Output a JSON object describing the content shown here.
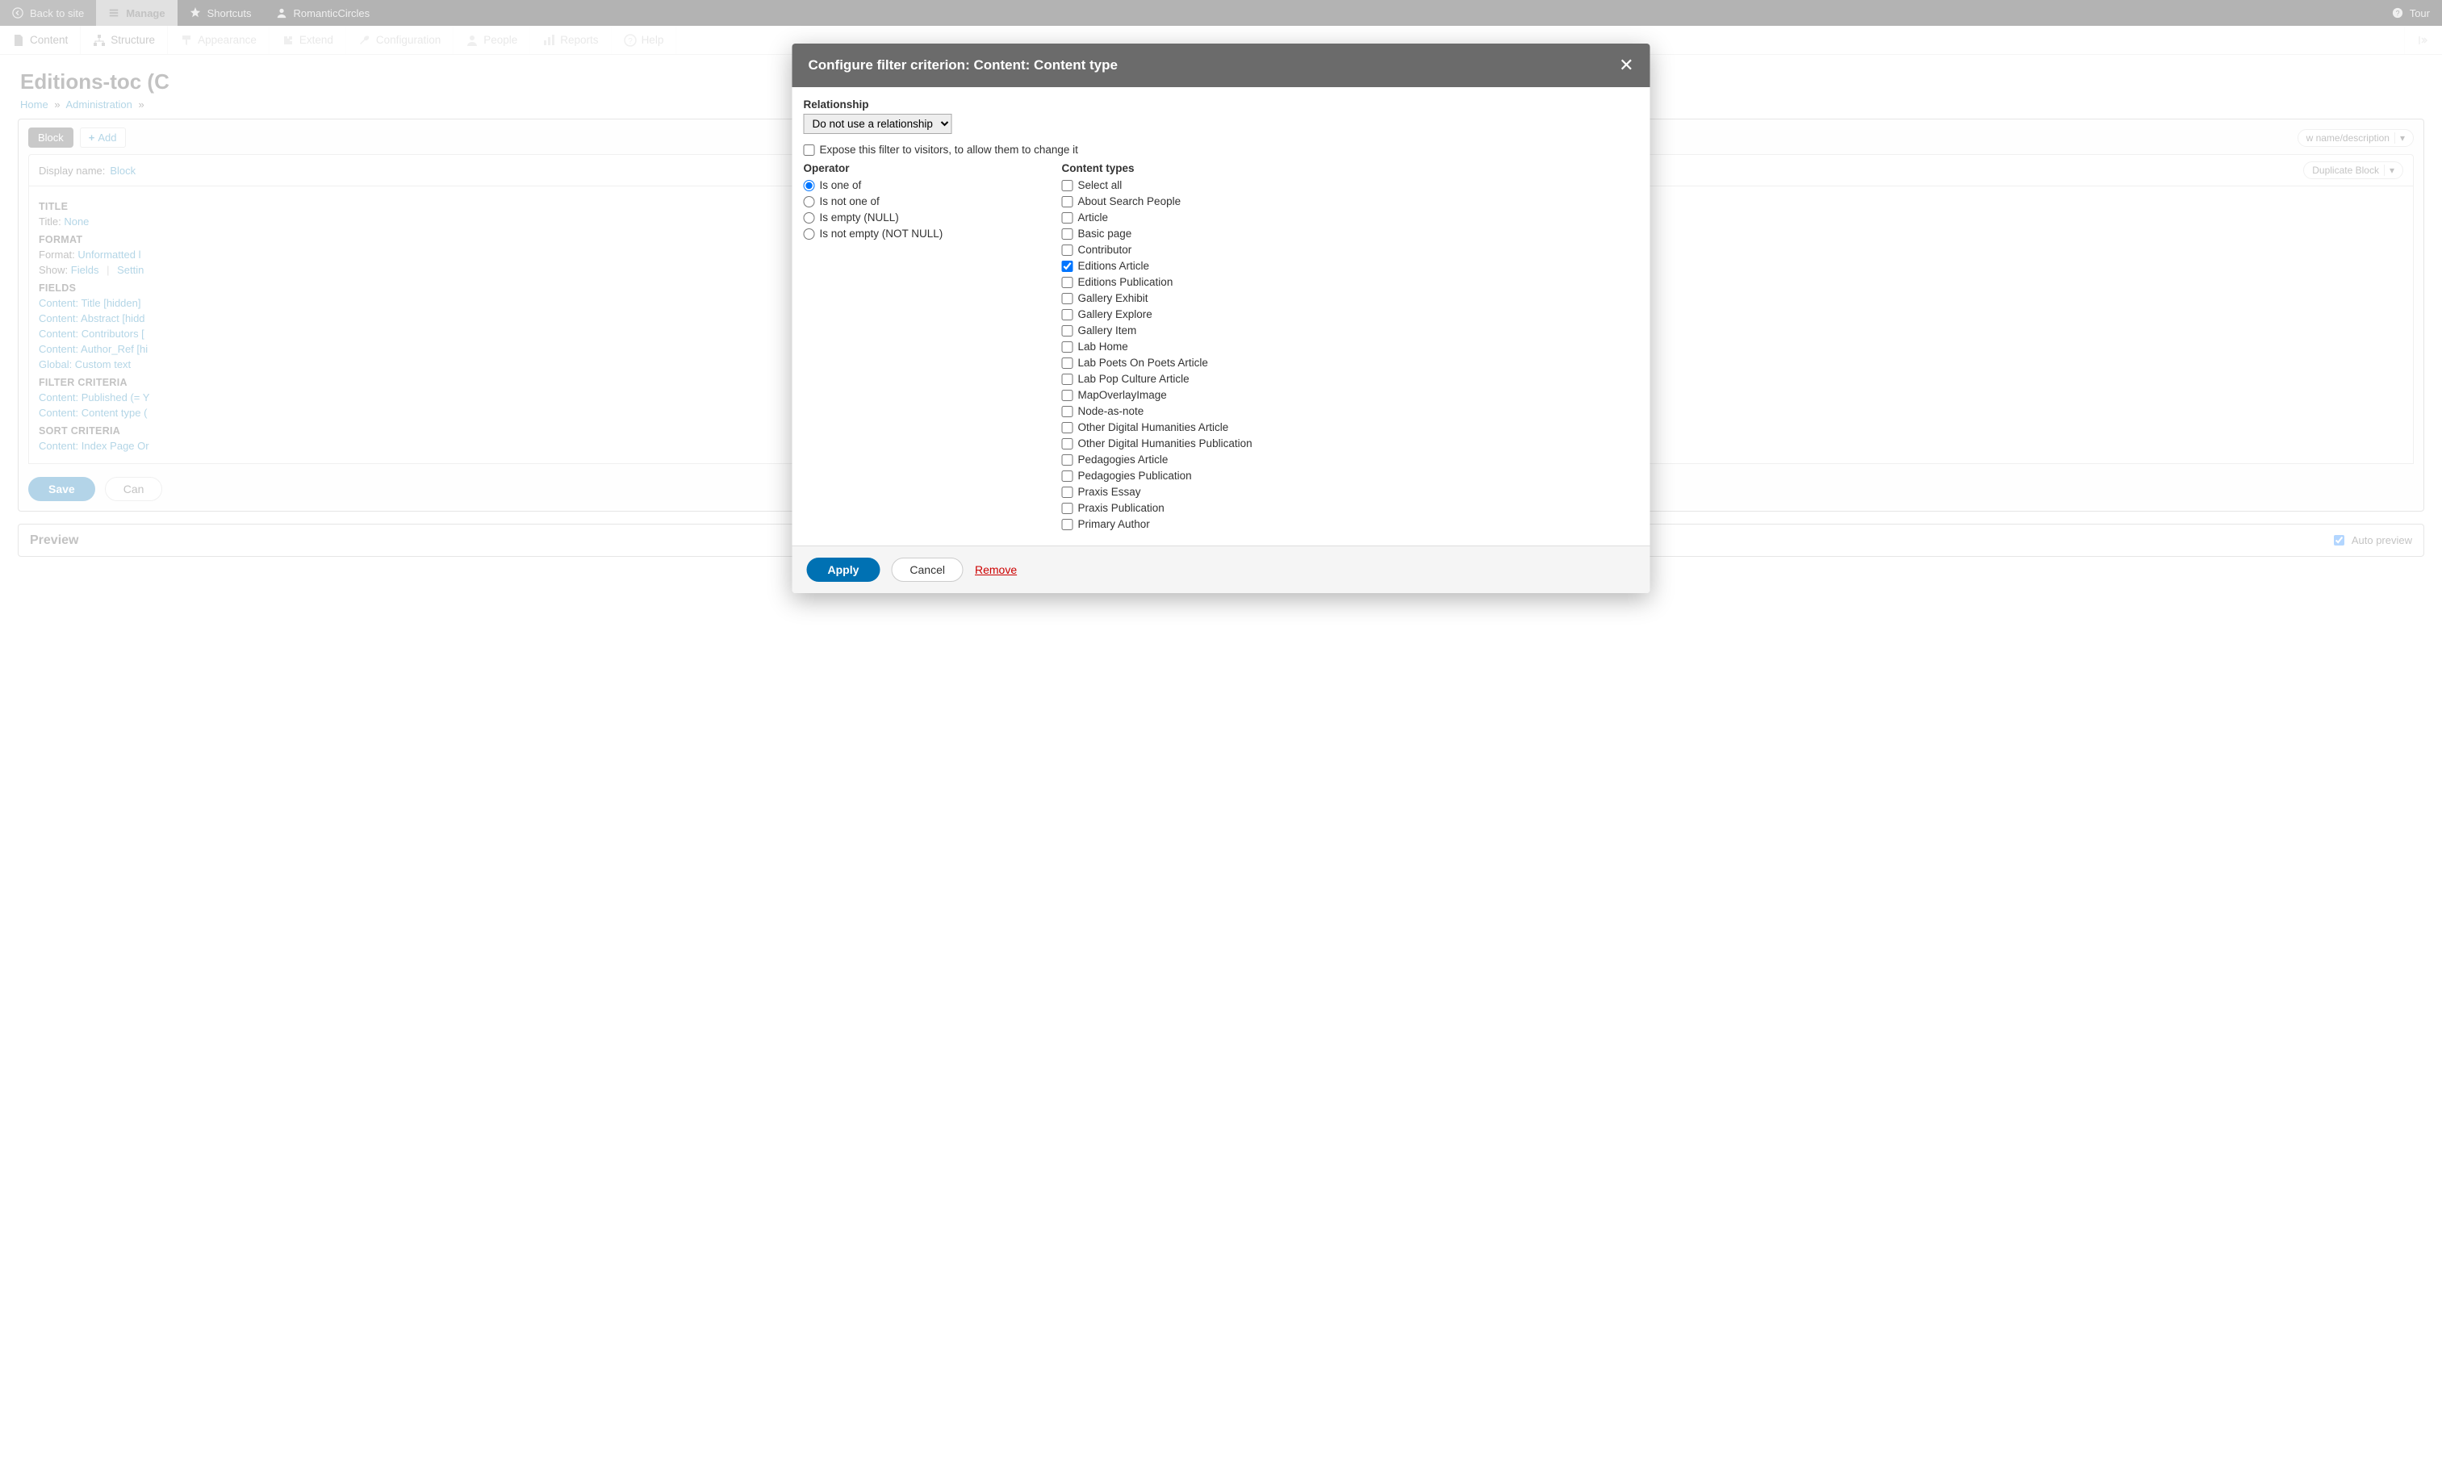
{
  "toolbar": {
    "back": "Back to site",
    "manage": "Manage",
    "shortcuts": "Shortcuts",
    "user": "RomanticCircles",
    "tour": "Tour"
  },
  "admin_menu": {
    "content": "Content",
    "structure": "Structure",
    "appearance": "Appearance",
    "extend": "Extend",
    "config": "Configuration",
    "people": "People",
    "reports": "Reports",
    "help": "Help"
  },
  "page": {
    "title": "Editions-toc (C"
  },
  "breadcrumb": {
    "home": "Home",
    "admin": "Administration"
  },
  "tabs": {
    "block": "Block",
    "add": "Add",
    "editview": "w name/description",
    "duplicate": "Duplicate Block"
  },
  "display": {
    "label": "Display name:",
    "value": "Block"
  },
  "sections": {
    "title": "TITLE",
    "title_label": "Title:",
    "title_value": "None",
    "format": "FORMAT",
    "format_label": "Format:",
    "format_value": "Unformatted l",
    "show_label": "Show:",
    "show_value": "Fields",
    "show_settings": "Settin",
    "fields": "FIELDS",
    "f1": "Content: Title [hidden]",
    "f2": "Content: Abstract [hidd",
    "f3": "Content: Contributors [",
    "f4": "Content: Author_Ref [hi",
    "f5": "Global: Custom text",
    "filter": "FILTER CRITERIA",
    "fc1": "Content: Published (= Y",
    "fc2": "Content: Content type (",
    "sort": "SORT CRITERIA",
    "s1": "Content: Index Page Or"
  },
  "actions": {
    "save": "Save",
    "cancel": "Can"
  },
  "preview": {
    "title": "Preview",
    "auto": "Auto preview"
  },
  "modal": {
    "title": "Configure filter criterion: Content: Content type",
    "relationship_label": "Relationship",
    "relationship_value": "Do not use a relationship",
    "expose": "Expose this filter to visitors, to allow them to change it",
    "operator_label": "Operator",
    "operators": {
      "o1": "Is one of",
      "o2": "Is not one of",
      "o3": "Is empty (NULL)",
      "o4": "Is not empty (NOT NULL)"
    },
    "types_label": "Content types",
    "types": {
      "t0": "Select all",
      "t1": "About Search People",
      "t2": "Article",
      "t3": "Basic page",
      "t4": "Contributor",
      "t5": "Editions Article",
      "t6": "Editions Publication",
      "t7": "Gallery Exhibit",
      "t8": "Gallery Explore",
      "t9": "Gallery Item",
      "t10": "Lab Home",
      "t11": "Lab Poets On Poets Article",
      "t12": "Lab Pop Culture Article",
      "t13": "MapOverlayImage",
      "t14": "Node-as-note",
      "t15": "Other Digital Humanities Article",
      "t16": "Other Digital Humanities Publication",
      "t17": "Pedagogies Article",
      "t18": "Pedagogies Publication",
      "t19": "Praxis Essay",
      "t20": "Praxis Publication",
      "t21": "Primary Author"
    },
    "apply": "Apply",
    "cancel": "Cancel",
    "remove": "Remove"
  }
}
